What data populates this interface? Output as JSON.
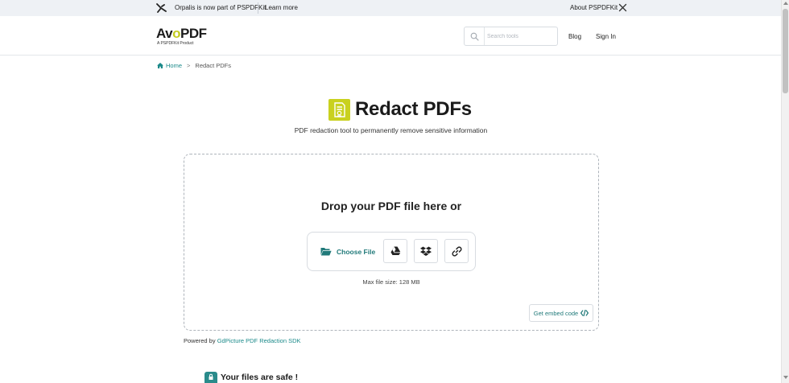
{
  "announcement": {
    "message": "Orpalis is now part of PSPDFKit",
    "learn_more": "Learn more",
    "about": "About PSPDFKit"
  },
  "header": {
    "brand_prefix": "Av",
    "brand_o": "o",
    "brand_suffix": "PDF",
    "brand_sub": "A PSPDFKit Product",
    "search_placeholder": "Search tools",
    "search_value": "",
    "nav_blog": "Blog",
    "nav_signin": "Sign In"
  },
  "breadcrumb": {
    "home": "Home",
    "separator": ">",
    "current": "Redact PDFs"
  },
  "tool": {
    "title": "Redact PDFs",
    "subtitle": "PDF redaction tool to permanently remove sensitive information",
    "icon": "document-redact-icon"
  },
  "upload": {
    "drop_title": "Drop your PDF file here or",
    "choose_file": "Choose File",
    "max_size": "Max file size: 128 MB",
    "embed": "Get embed code",
    "sources": [
      "google-drive-icon",
      "dropbox-icon",
      "link-icon"
    ]
  },
  "footer": {
    "powered_prefix": "Powered by",
    "powered_link": "GdPicture PDF Redaction SDK",
    "safe_title": "Your files are safe !"
  },
  "colors": {
    "accent": "#1b8a8a",
    "brand_yellow": "#c9d11f",
    "topbar_bg": "#eef1f5"
  }
}
